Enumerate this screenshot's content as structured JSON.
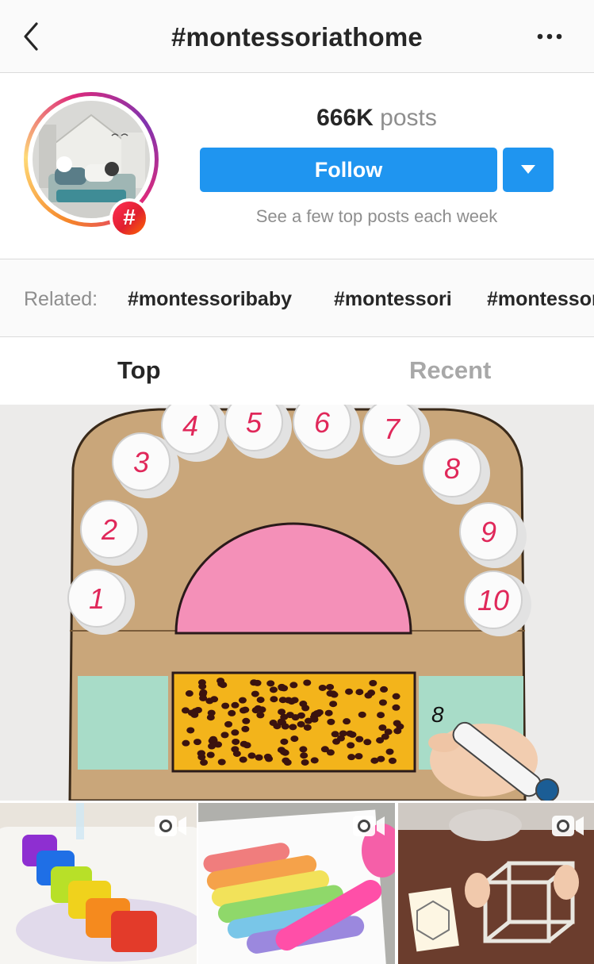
{
  "header": {
    "title": "#montessoriathome"
  },
  "profile": {
    "posts_count": "666K",
    "posts_label": "posts",
    "hash_symbol": "#",
    "follow_label": "Follow",
    "subtext": "See a few top posts each week"
  },
  "related": {
    "label": "Related:",
    "tags": [
      "#montessoribaby",
      "#montessori",
      "#montessori"
    ]
  },
  "tabs": {
    "top": "Top",
    "recent": "Recent",
    "active": "Top"
  },
  "hero": {
    "cup_numbers": [
      "1",
      "2",
      "3",
      "4",
      "5",
      "6",
      "7",
      "8",
      "9",
      "10"
    ],
    "card_note": "8"
  },
  "colors": {
    "accent": "#1f95f0",
    "text": "#262626",
    "muted": "#8e8e8e",
    "inactive_tab": "#a8a8a8"
  },
  "icons": [
    "back-chevron-icon",
    "more-dots-icon",
    "hashtag-badge-icon",
    "dropdown-caret-icon",
    "video-camera-icon"
  ]
}
